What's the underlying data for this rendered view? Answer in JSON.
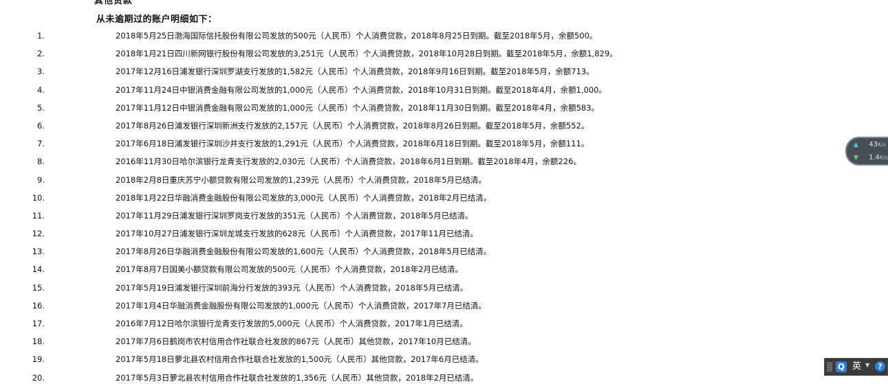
{
  "section_title_cut": "其他贷款",
  "subheading": "从未逾期过的账户明细如下：",
  "items": [
    {
      "num": "1.",
      "text": "2018年5月25日渤海国际信托股份有限公司发放的500元（人民币）个人消费贷款，2018年8月25日到期。截至2018年5月，余额500。"
    },
    {
      "num": "2.",
      "text": "2018年1月21日四川新网银行股份有限公司发放的3,251元（人民币）个人消费贷款，2018年10月28日到期。截至2018年5月，余额1,829。"
    },
    {
      "num": "3.",
      "text": "2017年12月16日浦发银行深圳罗湖支行发放的1,582元（人民币）个人消费贷款，2018年9月16日到期。截至2018年5月，余额713。"
    },
    {
      "num": "4.",
      "text": "2017年11月24日中银消费金融有限公司发放的1,000元（人民币）个人消费贷款，2018年10月31日到期。截至2018年4月，余额1,000。"
    },
    {
      "num": "5.",
      "text": "2017年11月12日中银消费金融有限公司发放的1,000元（人民币）个人消费贷款，2018年11月30日到期。截至2018年4月，余额583。"
    },
    {
      "num": "6.",
      "text": "2017年8月26日浦发银行深圳新洲支行发放的2,157元（人民币）个人消费贷款，2018年8月26日到期。截至2018年5月，余额552。"
    },
    {
      "num": "7.",
      "text": "2017年6月18日浦发银行深圳沙井支行发放的1,291元（人民币）个人消费贷款，2018年6月18日到期。截至2018年5月，余额111。"
    },
    {
      "num": "8.",
      "text": "2016年11月30日哈尔滨银行龙青支行发放的2,030元（人民币）个人消费贷款，2018年6月1日到期。截至2018年4月，余额226。"
    },
    {
      "num": "9.",
      "text": "2018年2月8日重庆苏宁小额贷款有限公司发放的1,239元（人民币）个人消费贷款，2018年5月已结清。"
    },
    {
      "num": "10.",
      "text": "2018年1月22日华融消费金融股份有限公司发放的3,000元（人民币）个人消费贷款，2018年2月已结清。"
    },
    {
      "num": "11.",
      "text": "2017年11月29日浦发银行深圳罗岗支行发放的351元（人民币）个人消费贷款，2018年5月已结清。"
    },
    {
      "num": "12.",
      "text": "2017年10月27日浦发银行深圳龙城支行发放的628元（人民币）个人消费贷款，2017年11月已结清。"
    },
    {
      "num": "13.",
      "text": "2017年8月26日华融消费金融股份有限公司发放的1,600元（人民币）个人消费贷款，2018年5月已结清。"
    },
    {
      "num": "14.",
      "text": "2017年8月7日国美小额贷款有限公司发放的500元（人民币）个人消费贷款，2018年2月已结清。"
    },
    {
      "num": "15.",
      "text": "2017年5月19日浦发银行深圳前海分行发放的393元（人民币）个人消费贷款，2018年5月已结清。"
    },
    {
      "num": "16.",
      "text": "2017年1月4日华融消费金融股份有限公司发放的1,000元（人民币）个人消费贷款，2017年7月已结清。"
    },
    {
      "num": "17.",
      "text": "2016年7月12日哈尔滨银行龙青支行发放的5,000元（人民币）个人消费贷款，2017年1月已结清。"
    },
    {
      "num": "18.",
      "text": "2017年7月6日鹤岗市农村信用合作社联合社发放的867元（人民币）其他贷款，2017年10月已结清。"
    },
    {
      "num": "19.",
      "text": "2017年5月18日萝北县农村信用合作社联合社发放的1,500元（人民币）其他贷款，2017年6月已结清。"
    },
    {
      "num": "20.",
      "text": "2017年5月3日萝北县农村信用合作社联合社发放的1,356元（人民币）其他贷款，2018年2月已结清。"
    }
  ],
  "speed_widget": {
    "upload_value": "43",
    "upload_unit": "K/s",
    "download_value": "1.4",
    "download_unit": "K/s"
  },
  "ime_toolbar": {
    "logo": "Q",
    "language": "英",
    "help": "?"
  }
}
